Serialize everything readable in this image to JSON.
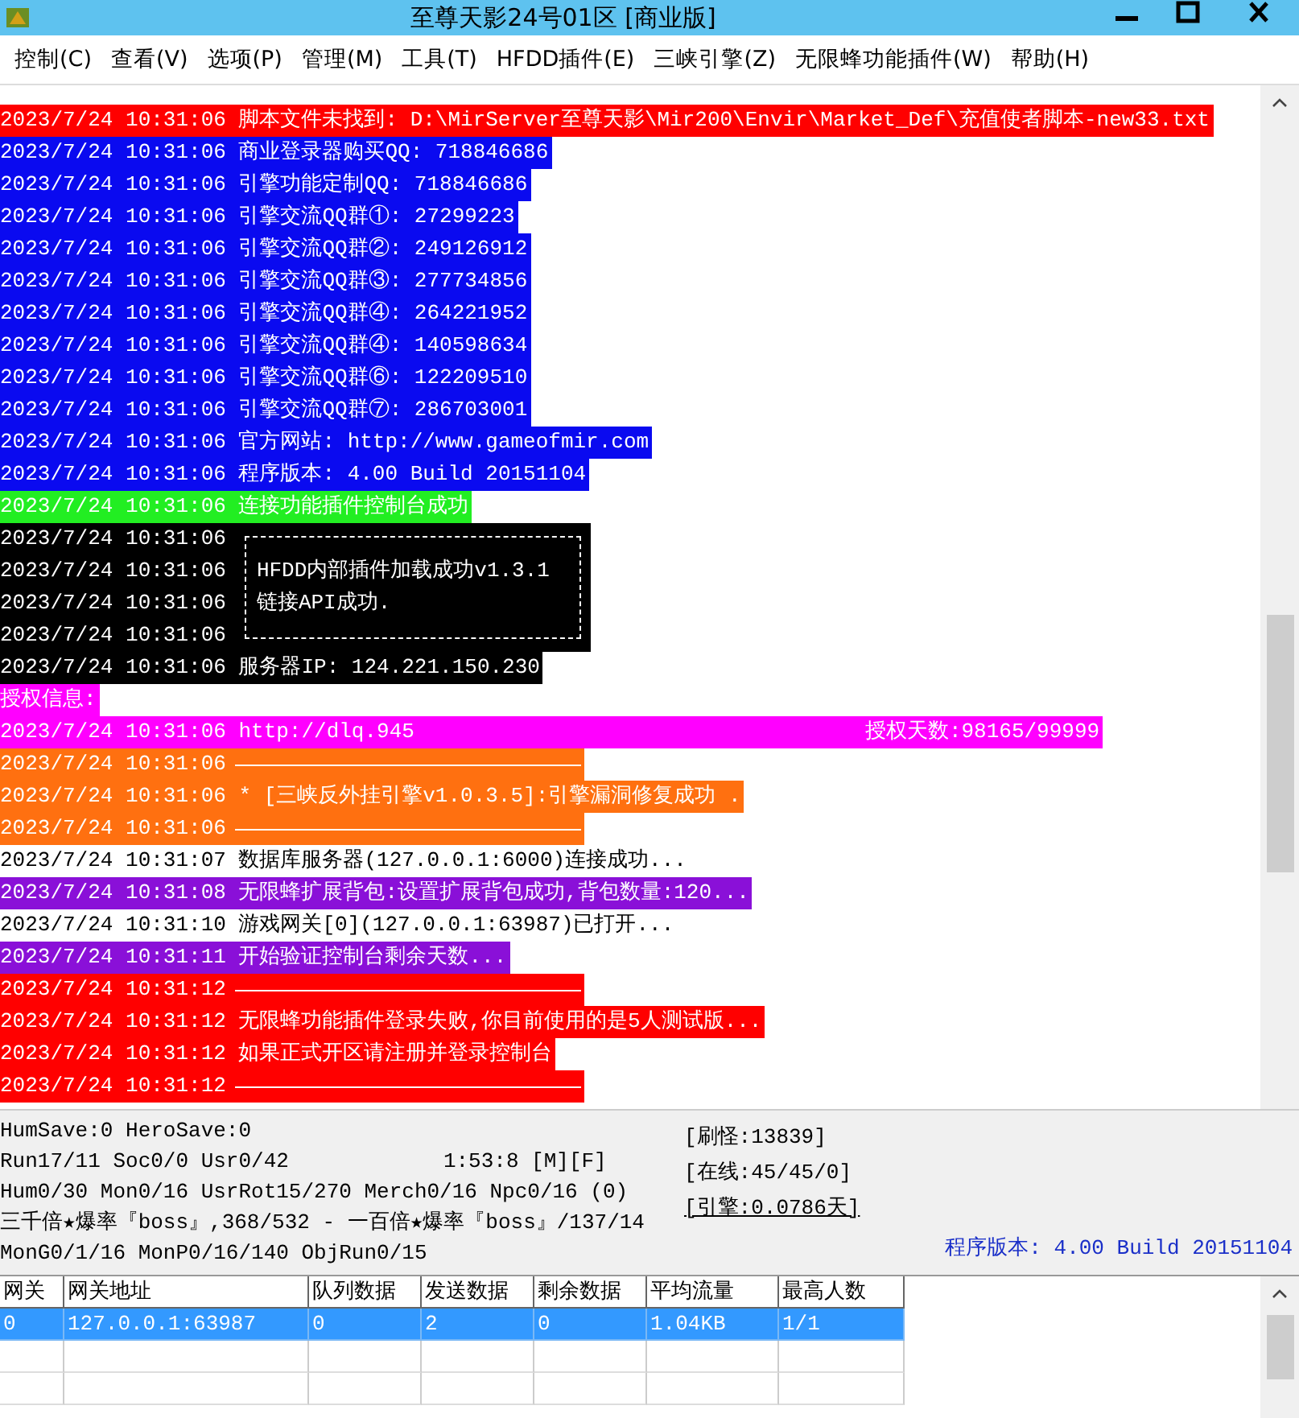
{
  "window": {
    "title": "至尊天影24号01区 [商业版]"
  },
  "menu": [
    "控制(C)",
    "查看(V)",
    "选项(P)",
    "管理(M)",
    "工具(T)",
    "HFDD插件(E)",
    "三峡引擎(Z)",
    "无限蜂功能插件(W)",
    "帮助(H)"
  ],
  "log": [
    {
      "kind": "text",
      "time": "2023/7/24 10:31:06",
      "text": "脚本文件未找到: D:\\MirServer至尊天影\\Mir200\\Envir\\Market_Def\\充值使者脚本-new33.txt",
      "color": "#ff0000"
    },
    {
      "kind": "text",
      "time": "2023/7/24 10:31:06",
      "text": "商业登录器购买QQ: 718846686",
      "color": "#0a0af0"
    },
    {
      "kind": "text",
      "time": "2023/7/24 10:31:06",
      "text": "引擎功能定制QQ: 718846686",
      "color": "#0a0af0"
    },
    {
      "kind": "text",
      "time": "2023/7/24 10:31:06",
      "text": "引擎交流QQ群①: 27299223",
      "color": "#0a0af0"
    },
    {
      "kind": "text",
      "time": "2023/7/24 10:31:06",
      "text": "引擎交流QQ群②: 249126912",
      "color": "#0a0af0"
    },
    {
      "kind": "text",
      "time": "2023/7/24 10:31:06",
      "text": "引擎交流QQ群③: 277734856",
      "color": "#0a0af0"
    },
    {
      "kind": "text",
      "time": "2023/7/24 10:31:06",
      "text": "引擎交流QQ群④: 264221952",
      "color": "#0a0af0"
    },
    {
      "kind": "text",
      "time": "2023/7/24 10:31:06",
      "text": "引擎交流QQ群④: 140598634",
      "color": "#0a0af0"
    },
    {
      "kind": "text",
      "time": "2023/7/24 10:31:06",
      "text": "引擎交流QQ群⑥: 122209510",
      "color": "#0a0af0"
    },
    {
      "kind": "text",
      "time": "2023/7/24 10:31:06",
      "text": "引擎交流QQ群⑦: 286703001",
      "color": "#0a0af0"
    },
    {
      "kind": "text",
      "time": "2023/7/24 10:31:06",
      "text": "官方网站: http://www.gameofmir.com",
      "color": "#0a0af0"
    },
    {
      "kind": "text",
      "time": "2023/7/24 10:31:06",
      "text": "程序版本: 4.00 Build 20151104",
      "color": "#0a0af0"
    },
    {
      "kind": "text",
      "time": "2023/7/24 10:31:06",
      "text": "连接功能插件控制台成功",
      "color": "#22ee22"
    },
    {
      "kind": "box",
      "times": [
        "2023/7/24 10:31:06",
        "2023/7/24 10:31:06",
        "2023/7/24 10:31:06",
        "2023/7/24 10:31:06"
      ],
      "lines": [
        "HFDD内部插件加载成功v1.3.1",
        "链接API成功."
      ],
      "color": "#000000"
    },
    {
      "kind": "text",
      "time": "2023/7/24 10:31:06",
      "text": "服务器IP: 124.221.150.230",
      "color": "#000000"
    },
    {
      "kind": "label",
      "text": "授权信息:",
      "color": "#ff00ff"
    },
    {
      "kind": "text",
      "time": "2023/7/24 10:31:06",
      "text": "http://dlq.945",
      "extra": "授权天数:98165/99999",
      "color": "#ff00ff"
    },
    {
      "kind": "rule",
      "time": "2023/7/24 10:31:06",
      "color": "#ff7010"
    },
    {
      "kind": "text",
      "time": "2023/7/24 10:31:06",
      "text": "* [三峡反外挂引擎v1.0.3.5]:引擎漏洞修复成功 .",
      "color": "#ff7010"
    },
    {
      "kind": "rule",
      "time": "2023/7/24 10:31:06",
      "color": "#ff7010"
    },
    {
      "kind": "text",
      "time": "2023/7/24 10:31:07",
      "text": "数据库服务器(127.0.0.1:6000)连接成功...",
      "color": "#ffffff"
    },
    {
      "kind": "text",
      "time": "2023/7/24 10:31:08",
      "text": "无限蜂扩展背包:设置扩展背包成功,背包数量:120...",
      "color": "#8a10d8"
    },
    {
      "kind": "text",
      "time": "2023/7/24 10:31:10",
      "text": "游戏网关[0](127.0.0.1:63987)已打开...",
      "color": "#ffffff"
    },
    {
      "kind": "text",
      "time": "2023/7/24 10:31:11",
      "text": "开始验证控制台剩余天数...",
      "color": "#8a10d8"
    },
    {
      "kind": "rule",
      "time": "2023/7/24 10:31:12",
      "color": "#ff0000"
    },
    {
      "kind": "text",
      "time": "2023/7/24 10:31:12",
      "text": "无限蜂功能插件登录失败,你目前使用的是5人测试版...",
      "color": "#ff0000"
    },
    {
      "kind": "text",
      "time": "2023/7/24 10:31:12",
      "text": "如果正式开区请注册并登录控制台",
      "color": "#ff0000"
    },
    {
      "kind": "rule",
      "time": "2023/7/24 10:31:12",
      "color": "#ff0000"
    }
  ],
  "status": {
    "left": [
      "HumSave:0 HeroSave:0",
      "Run17/11 Soc0/0 Usr0/42",
      "Hum0/30 Mon0/16 UsrRot15/270 Merch0/16 Npc0/16 (0)",
      "三千倍★爆率『boss』,368/532 - 一百倍★爆率『boss』/137/14",
      "MonG0/1/16 MonP0/16/140 ObjRun0/15"
    ],
    "clock": "1:53:8 [M][F]",
    "right": [
      "[刷怪:13839]",
      "[在线:45/45/0]",
      "[引擎:0.0786天]"
    ],
    "version": "程序版本: 4.00 Build 20151104"
  },
  "table": {
    "columns": [
      "网关",
      "网关地址",
      "队列数据",
      "发送数据",
      "剩余数据",
      "平均流量",
      "最高人数"
    ],
    "rows": [
      {
        "cells": [
          "0",
          "127.0.0.1:63987",
          "0",
          "2",
          "0",
          "1.04KB",
          "1/1"
        ],
        "selected": true
      }
    ]
  }
}
